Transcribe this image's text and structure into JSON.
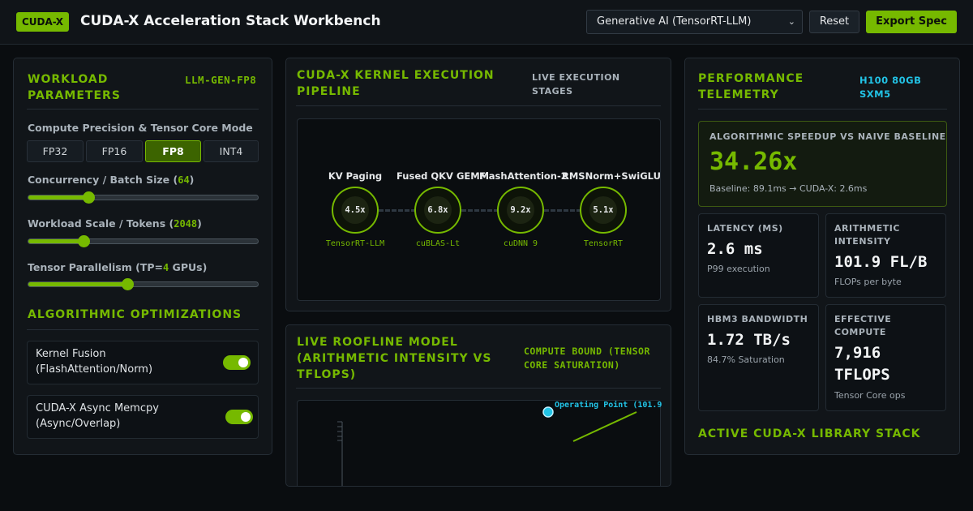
{
  "header": {
    "badge": "CUDA-X",
    "title": "CUDA-X Acceleration Stack Workbench",
    "preset": "Generative AI (TensorRT-LLM)",
    "reset_label": "Reset",
    "export_label": "Export Spec"
  },
  "workload": {
    "title": "WORKLOAD PARAMETERS",
    "tag": "LLM-GEN-FP8",
    "precision_label": "Compute Precision & Tensor Core Mode",
    "precision_options": [
      "FP32",
      "FP16",
      "FP8",
      "INT4"
    ],
    "precision_selected": "FP8",
    "sliders": [
      {
        "label": "Concurrency / Batch Size (",
        "value": "64",
        "suffix": ")",
        "fraction": 0.26
      },
      {
        "label": "Workload Scale / Tokens (",
        "value": "2048",
        "suffix": ")",
        "fraction": 0.24
      },
      {
        "label": "Tensor Parallelism (TP=",
        "value": "4",
        "suffix": " GPUs)",
        "fraction": 0.43
      }
    ]
  },
  "optimizations": {
    "title": "ALGORITHMIC OPTIMIZATIONS",
    "items": [
      {
        "label": "Kernel Fusion (FlashAttention/Norm)",
        "enabled": true
      },
      {
        "label": "CUDA-X Async Memcpy (Async/Overlap)",
        "enabled": true
      }
    ]
  },
  "pipeline": {
    "title": "CUDA-X KERNEL EXECUTION PIPELINE",
    "tag": "LIVE EXECUTION STAGES",
    "stages": [
      {
        "name": "KV Paging",
        "speedup": "4.5x",
        "library": "TensorRT-LLM"
      },
      {
        "name": "Fused QKV GEMM",
        "speedup": "6.8x",
        "library": "cuBLAS-Lt"
      },
      {
        "name": "FlashAttention-2",
        "speedup": "9.2x",
        "library": "cuDNN 9"
      },
      {
        "name": "RMSNorm+SwiGLU",
        "speedup": "5.1x",
        "library": "TensorRT"
      }
    ]
  },
  "roofline": {
    "title": "LIVE ROOFLINE MODEL (ARITHMETIC INTENSITY VS TFLOPS)",
    "tag": "COMPUTE BOUND (TENSOR CORE SATURATION)",
    "operating_point_label": "Operating Point (101.9"
  },
  "telemetry": {
    "title": "PERFORMANCE TELEMETRY",
    "tag": "H100 80GB SXM5",
    "speedup": {
      "title": "ALGORITHMIC SPEEDUP VS NAIVE BASELINE",
      "value": "34.26x",
      "baseline": "Baseline: 89.1ms → CUDA-X: 2.6ms"
    },
    "metrics": [
      {
        "title": "LATENCY (MS)",
        "value": "2.6 ms",
        "sub": "P99 execution"
      },
      {
        "title": "ARITHMETIC INTENSITY",
        "value": "101.9 FL/B",
        "sub": "FLOPs per byte"
      },
      {
        "title": "HBM3 BANDWIDTH",
        "value": "1.72 TB/s",
        "sub": "84.7% Saturation"
      },
      {
        "title": "EFFECTIVE COMPUTE",
        "value": "7,916 TFLOPS",
        "sub": "Tensor Core ops"
      }
    ],
    "library_stack_title": "ACTIVE CUDA-X LIBRARY STACK"
  },
  "colors": {
    "accent": "#76b900",
    "cyan": "#22c3e6",
    "background": "#0a0d10"
  }
}
